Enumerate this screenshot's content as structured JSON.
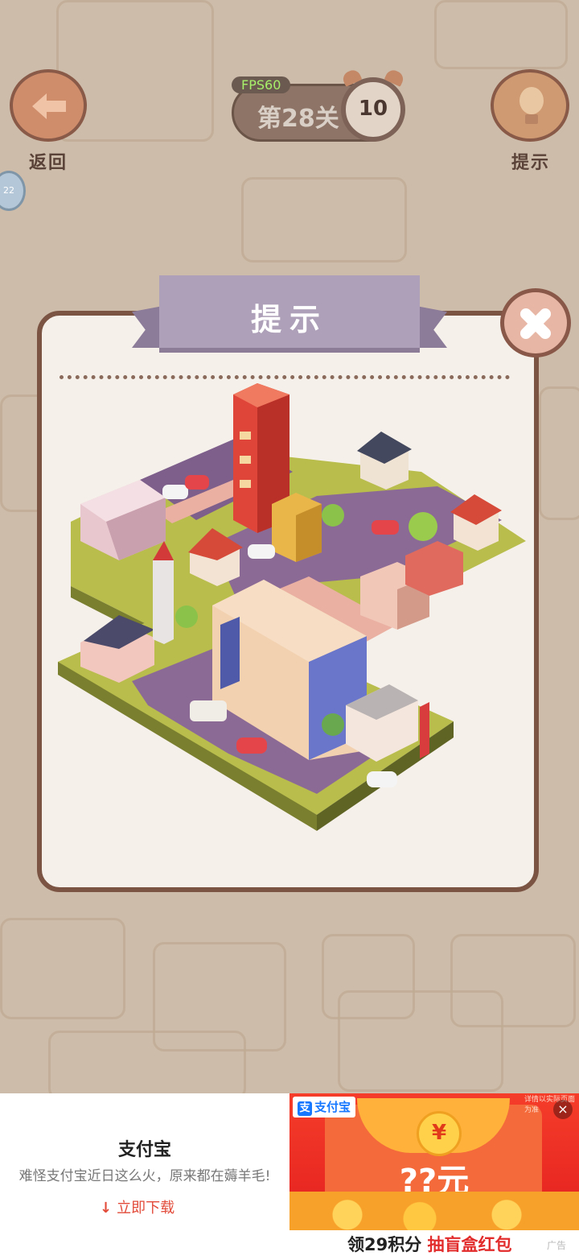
{
  "hud": {
    "back_label": "返回",
    "fps": "FPS60",
    "level": "第28关",
    "timer": "10",
    "hint_label": "提示",
    "side_badge": "22"
  },
  "dialog": {
    "title": "提示",
    "image": "isometric-city-block-hint"
  },
  "ad": {
    "title": "支付宝",
    "description": "难怪支付宝近日这么火，原来都在薅羊毛!",
    "cta": "立即下载",
    "brand": "支付宝",
    "amount": "??元",
    "coin_symbol": "¥",
    "caption_prefix": "领29积分",
    "caption_highlight": "抽盲盒红包",
    "ad_marker": "广告",
    "fine_print": "详情以实际页面为准",
    "close": "×"
  },
  "colors": {
    "dialog_bg": "#f5f1ea",
    "dialog_border": "#7b5444",
    "ribbon": "#aea0b8",
    "ad_red": "#e22c2c"
  }
}
